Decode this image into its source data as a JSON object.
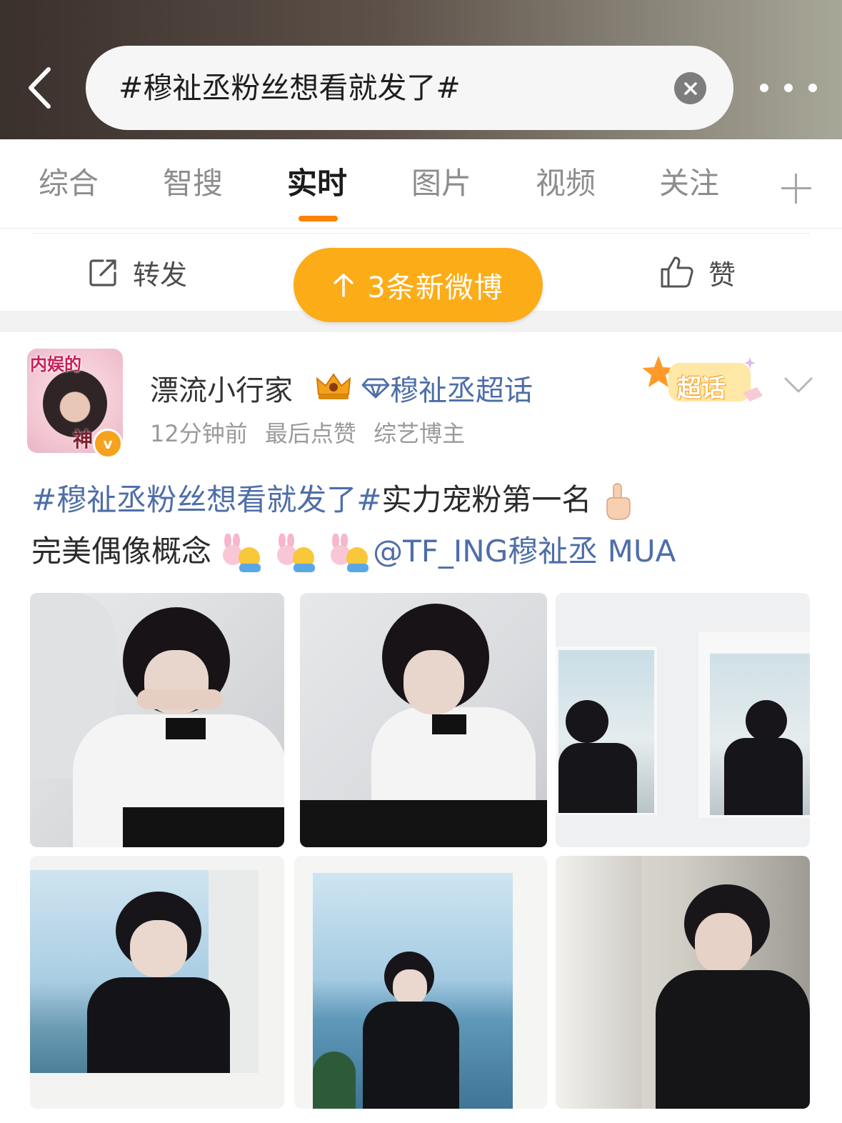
{
  "header": {
    "search_query": "#穆祉丞粉丝想看就发了#"
  },
  "tabs": [
    {
      "label": "综合",
      "active": false
    },
    {
      "label": "智搜",
      "active": false
    },
    {
      "label": "实时",
      "active": true
    },
    {
      "label": "图片",
      "active": false
    },
    {
      "label": "视频",
      "active": false
    },
    {
      "label": "关注",
      "active": false
    }
  ],
  "actions": {
    "repost_label": "转发",
    "like_label": "赞"
  },
  "new_posts_pill": {
    "label": "3条新微博"
  },
  "post": {
    "username": "漂流小行家",
    "supertopic_name": "穆祉丞超话",
    "supertopic_badge": "超话",
    "avatar_text_top": "内娱的",
    "avatar_text_bottom": "神",
    "meta": {
      "time": "12分钟前",
      "last_like": "最后点赞",
      "role": "综艺博主"
    },
    "topic_tag": "#穆祉丞粉丝想看就发了#",
    "text_after_tag": "实力宠粉第一名",
    "text_line2": "完美偶像概念",
    "mention": "@TF_ING穆祉丞",
    "text_tail": "MUA",
    "image_count": 6
  },
  "colors": {
    "accent_orange": "#ff8200",
    "pill_yellow": "#fcac17",
    "link_blue": "#4e6ea8"
  }
}
